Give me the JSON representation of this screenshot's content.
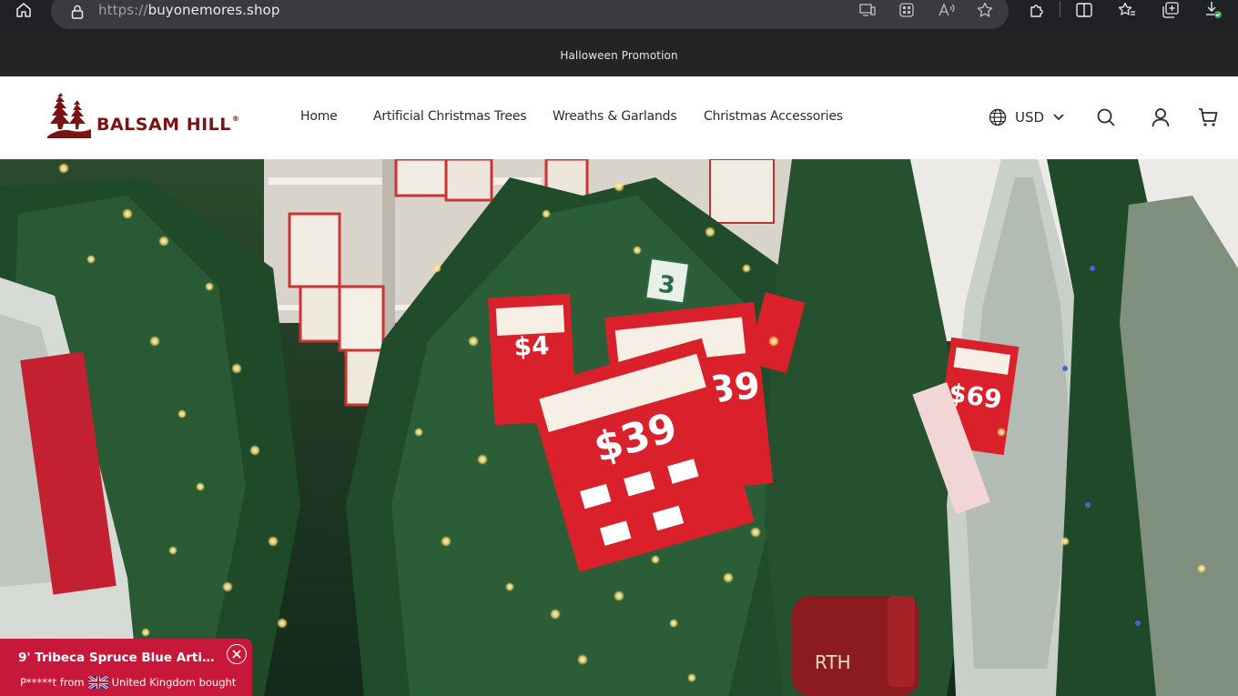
{
  "browser": {
    "url_scheme": "https://",
    "url_host": "buyonemores.shop"
  },
  "promo": {
    "text": "Halloween Promotion"
  },
  "header": {
    "logo_text": "BALSAM HILL",
    "logo_reg": "®",
    "nav": [
      {
        "label": "Home"
      },
      {
        "label": "Artificial Christmas Trees"
      },
      {
        "label": "Wreaths & Garlands"
      },
      {
        "label": "Christmas Accessories"
      }
    ],
    "currency": "USD"
  },
  "hero": {
    "price_tags": [
      "$39",
      "$39",
      "$69",
      "$4"
    ],
    "aisle_sign": "3",
    "mailbox_text": "RTH"
  },
  "toast": {
    "title": "9' Tribeca Spruce Blue Artificial ...",
    "buyer": "P*****t from",
    "country": "United Kingdom bought"
  },
  "colors": {
    "promo_bg": "#242424",
    "brand": "#7a1414",
    "toast_bg": "#c8183a",
    "tag_red": "#d9202b"
  }
}
